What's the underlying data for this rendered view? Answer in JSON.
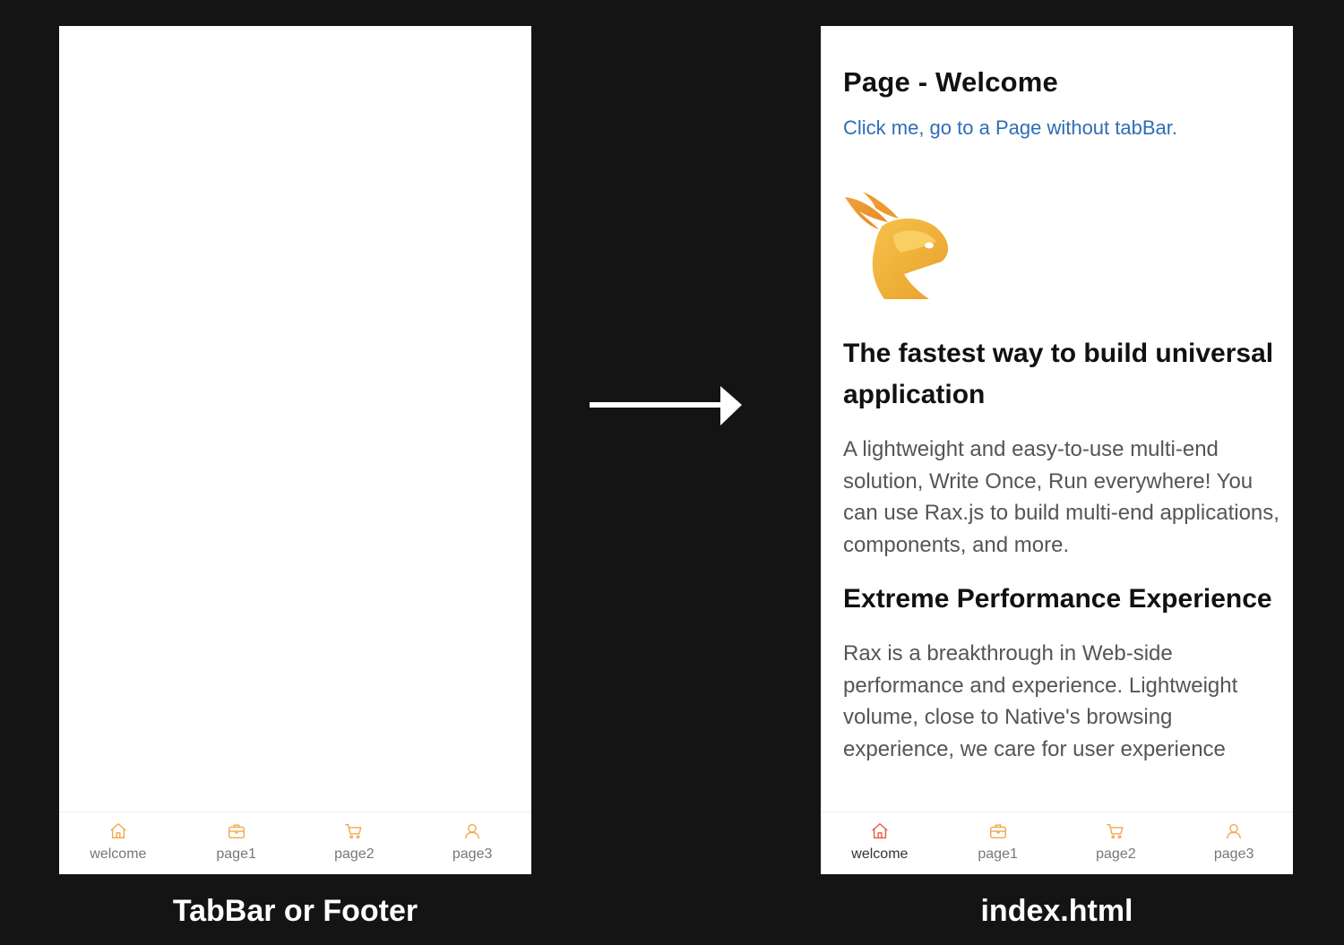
{
  "tabbar": {
    "items": [
      {
        "label": "welcome",
        "icon": "home-icon"
      },
      {
        "label": "page1",
        "icon": "briefcase-icon"
      },
      {
        "label": "page2",
        "icon": "cart-icon"
      },
      {
        "label": "page3",
        "icon": "user-icon"
      }
    ],
    "icon_color": "#f0a74a",
    "active_icon_color": "#e8604c"
  },
  "left_caption": "TabBar or Footer",
  "right_caption": "index.html",
  "page": {
    "title": "Page - Welcome",
    "link": "Click me, go to a Page without tabBar.",
    "logo": "rax-logo",
    "sections": [
      {
        "title": "The fastest way to build universal application",
        "text": "A lightweight and easy-to-use multi-end solution, Write Once, Run everywhere! You can use Rax.js to build multi-end applications, components, and more."
      },
      {
        "title": "Extreme Performance Experience",
        "text": "Rax is a breakthrough in Web-side performance and experience. Lightweight volume, close to Native's browsing experience, we care for user experience"
      }
    ]
  },
  "colors": {
    "background": "#141414",
    "link": "#2f6db5",
    "logo_gold": "#f2b233"
  }
}
